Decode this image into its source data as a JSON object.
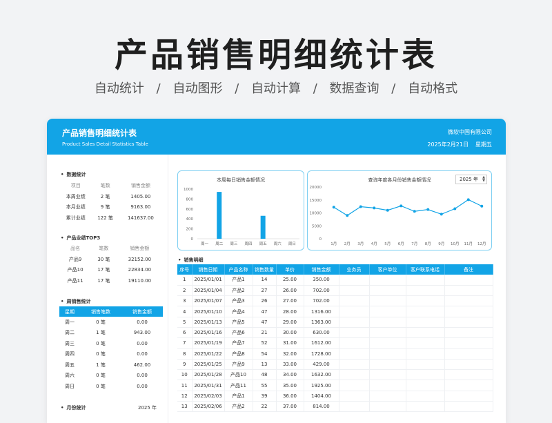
{
  "hero": {
    "title": "产品销售明细统计表",
    "features": [
      "自动统计",
      "/",
      "自动图形",
      "/",
      "自动计算",
      "/",
      "数据查询",
      "/",
      "自动格式"
    ]
  },
  "banner": {
    "title": "产品销售明细统计表",
    "subtitle": "Product Sales Detail Statistics Table",
    "company": "微软中国有限公司",
    "date": "2025年2月21日",
    "weekday": "星期五"
  },
  "stats": {
    "title": "数据统计",
    "headers": [
      "项目",
      "笔数",
      "销售金额"
    ],
    "rows": [
      [
        "本周业绩",
        "2 笔",
        "1405.00"
      ],
      [
        "本月业绩",
        "9 笔",
        "9163.00"
      ],
      [
        "累计业绩",
        "122 笔",
        "141637.00"
      ]
    ]
  },
  "top3": {
    "title": "产品业绩TOP3",
    "headers": [
      "品名",
      "笔数",
      "销售金额"
    ],
    "rows": [
      [
        "产品9",
        "30 笔",
        "32152.00"
      ],
      [
        "产品10",
        "17 笔",
        "22834.00"
      ],
      [
        "产品11",
        "17 笔",
        "19110.00"
      ]
    ]
  },
  "weekly": {
    "title": "周销售统计",
    "headers": [
      "星期",
      "销售笔数",
      "销售金额"
    ],
    "rows": [
      [
        "周一",
        "0 笔",
        "0.00"
      ],
      [
        "周二",
        "1 笔",
        "943.00"
      ],
      [
        "周三",
        "0 笔",
        "0.00"
      ],
      [
        "周四",
        "0 笔",
        "0.00"
      ],
      [
        "周五",
        "1 笔",
        "462.00"
      ],
      [
        "周六",
        "0 笔",
        "0.00"
      ],
      [
        "周日",
        "0 笔",
        "0.00"
      ]
    ]
  },
  "monthly": {
    "title": "月份统计",
    "year": "2025 年"
  },
  "chart_data": [
    {
      "type": "bar",
      "title": "本周每日销售金额情况",
      "categories": [
        "周一",
        "周二",
        "周三",
        "周四",
        "周五",
        "周六",
        "周日"
      ],
      "values": [
        0,
        943,
        0,
        0,
        462,
        0,
        0
      ],
      "ylim": [
        0,
        1000
      ],
      "yticks": [
        0,
        200,
        400,
        600,
        800,
        1000
      ],
      "color": "#12a4e6"
    },
    {
      "type": "line",
      "title": "查询年度各月份销售金额情况",
      "year_select": "2025 年",
      "categories": [
        "1月",
        "2月",
        "3月",
        "4月",
        "5月",
        "6月",
        "7月",
        "8月",
        "9月",
        "10月",
        "11月",
        "12月"
      ],
      "values": [
        12200,
        9000,
        12400,
        11900,
        11000,
        12700,
        10600,
        11300,
        9500,
        11600,
        15100,
        12600
      ],
      "ylim": [
        0,
        20000
      ],
      "yticks": [
        0,
        5000,
        10000,
        15000,
        20000
      ],
      "color": "#12a4e6"
    }
  ],
  "detail": {
    "title": "销售明细",
    "headers": [
      "序号",
      "销售日期",
      "产品名称",
      "销售数量",
      "单价",
      "销售金额",
      "业务员",
      "客户单位",
      "客户联系电话",
      "备注"
    ],
    "rows": [
      [
        "1",
        "2025/01/01",
        "产品1",
        "14",
        "25.00",
        "350.00"
      ],
      [
        "2",
        "2025/01/04",
        "产品2",
        "27",
        "26.00",
        "702.00"
      ],
      [
        "3",
        "2025/01/07",
        "产品3",
        "26",
        "27.00",
        "702.00"
      ],
      [
        "4",
        "2025/01/10",
        "产品4",
        "47",
        "28.00",
        "1316.00"
      ],
      [
        "5",
        "2025/01/13",
        "产品5",
        "47",
        "29.00",
        "1363.00"
      ],
      [
        "6",
        "2025/01/16",
        "产品6",
        "21",
        "30.00",
        "630.00"
      ],
      [
        "7",
        "2025/01/19",
        "产品7",
        "52",
        "31.00",
        "1612.00"
      ],
      [
        "8",
        "2025/01/22",
        "产品8",
        "54",
        "32.00",
        "1728.00"
      ],
      [
        "9",
        "2025/01/25",
        "产品9",
        "13",
        "33.00",
        "429.00"
      ],
      [
        "10",
        "2025/01/28",
        "产品10",
        "48",
        "34.00",
        "1632.00"
      ],
      [
        "11",
        "2025/01/31",
        "产品11",
        "55",
        "35.00",
        "1925.00"
      ],
      [
        "12",
        "2025/02/03",
        "产品1",
        "39",
        "36.00",
        "1404.00"
      ],
      [
        "13",
        "2025/02/06",
        "产品2",
        "22",
        "37.00",
        "814.00"
      ]
    ]
  }
}
